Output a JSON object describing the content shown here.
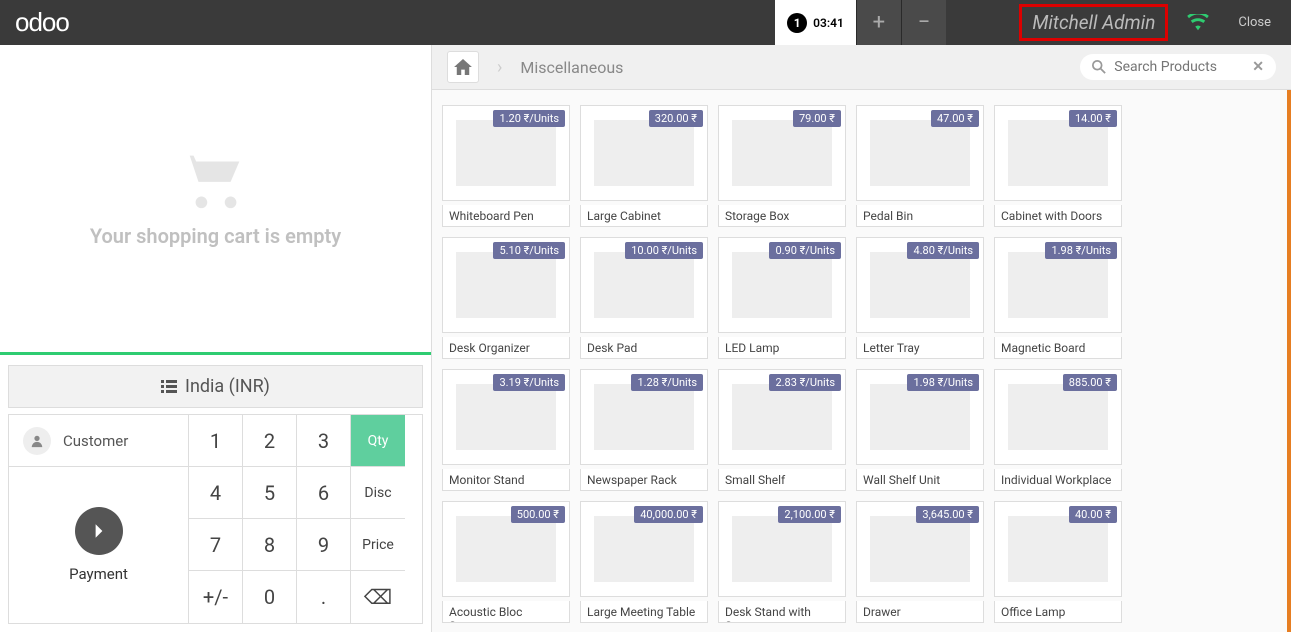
{
  "topbar": {
    "logo": "odoo",
    "tab_number": "1",
    "tab_time": "03:41",
    "user": "Mitchell Admin",
    "close": "Close"
  },
  "cart": {
    "empty_text": "Your shopping cart is empty"
  },
  "currency": {
    "label": "India (INR)"
  },
  "customer": {
    "label": "Customer"
  },
  "payment": {
    "label": "Payment"
  },
  "keys": {
    "k1": "1",
    "k2": "2",
    "k3": "3",
    "qty": "Qty",
    "k4": "4",
    "k5": "5",
    "k6": "6",
    "disc": "Disc",
    "k7": "7",
    "k8": "8",
    "k9": "9",
    "price": "Price",
    "pm": "+/-",
    "k0": "0",
    "dot": ".",
    "back": "⌫"
  },
  "breadcrumb": {
    "category": "Miscellaneous"
  },
  "search": {
    "placeholder": "Search Products"
  },
  "products": [
    [
      {
        "name": "Whiteboard Pen",
        "price": "1.20 ₹/Units"
      },
      {
        "name": "Large Cabinet",
        "price": "320.00 ₹"
      },
      {
        "name": "Storage Box",
        "price": "79.00 ₹"
      },
      {
        "name": "Pedal Bin",
        "price": "47.00 ₹"
      },
      {
        "name": "Cabinet with Doors",
        "price": "14.00 ₹"
      }
    ],
    [
      {
        "name": "Desk Organizer",
        "price": "5.10 ₹/Units"
      },
      {
        "name": "Desk Pad",
        "price": "10.00 ₹/Units"
      },
      {
        "name": "LED Lamp",
        "price": "0.90 ₹/Units"
      },
      {
        "name": "Letter Tray",
        "price": "4.80 ₹/Units"
      },
      {
        "name": "Magnetic Board",
        "price": "1.98 ₹/Units"
      }
    ],
    [
      {
        "name": "Monitor Stand",
        "price": "3.19 ₹/Units"
      },
      {
        "name": "Newspaper Rack",
        "price": "1.28 ₹/Units"
      },
      {
        "name": "Small Shelf",
        "price": "2.83 ₹/Units"
      },
      {
        "name": "Wall Shelf Unit",
        "price": "1.98 ₹/Units"
      },
      {
        "name": "Individual Workplace",
        "price": "885.00 ₹"
      }
    ],
    [
      {
        "name": "Acoustic Bloc Screens",
        "price": "500.00 ₹"
      },
      {
        "name": "Large Meeting Table",
        "price": "40,000.00 ₹"
      },
      {
        "name": "Desk Stand with Screen",
        "price": "2,100.00 ₹"
      },
      {
        "name": "Drawer",
        "price": "3,645.00 ₹"
      },
      {
        "name": "Office Lamp",
        "price": "40.00 ₹"
      }
    ]
  ]
}
